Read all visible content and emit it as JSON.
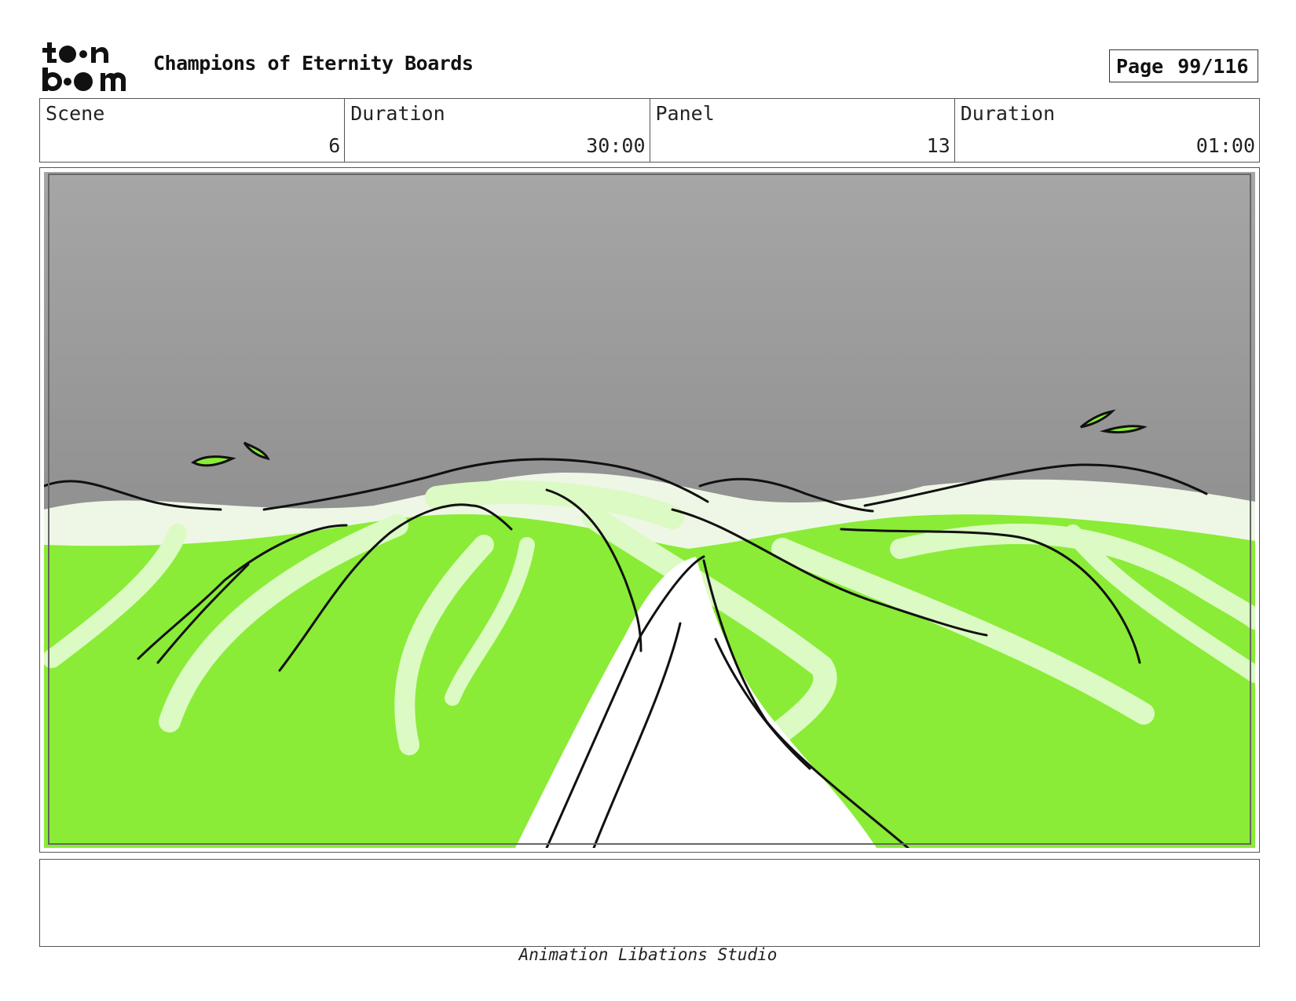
{
  "header": {
    "logo_text_top": "to•n",
    "logo_text_bottom": "b••m",
    "title": "Champions of Eternity Boards",
    "page_label": "Page",
    "page_value": "99/116"
  },
  "info": {
    "scene_label": "Scene",
    "scene_value": "6",
    "scene_duration_label": "Duration",
    "scene_duration_value": "30:00",
    "panel_label": "Panel",
    "panel_value": "13",
    "panel_duration_label": "Duration",
    "panel_duration_value": "01:00"
  },
  "panel": {
    "sky_color_top": "#a6a6a6",
    "sky_color_bottom": "#7c7c7c",
    "grass_color": "#8aec36",
    "highlight_color": "#dcfac4",
    "road_color": "#ffffff"
  },
  "notes": {
    "text": ""
  },
  "footer": {
    "studio": "Animation Libations Studio"
  }
}
